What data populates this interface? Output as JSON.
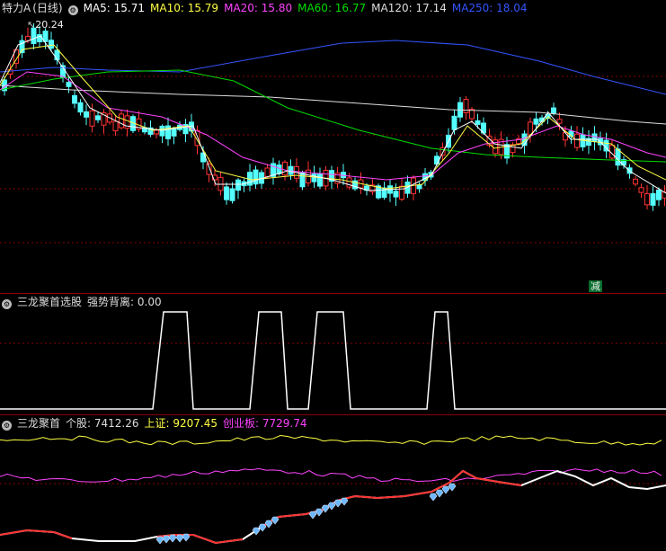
{
  "main_panel": {
    "stock_name": "特力A",
    "period": "(日线)",
    "ma": [
      {
        "label": "MA5: 15.71",
        "color": "#ffffff"
      },
      {
        "label": "MA10: 15.79",
        "color": "#ffff44"
      },
      {
        "label": "MA20: 15.80",
        "color": "#ff44ff"
      },
      {
        "label": "MA60: 16.77",
        "color": "#00dd00"
      },
      {
        "label": "MA120: 17.14",
        "color": "#dddddd"
      },
      {
        "label": "MA250: 18.04",
        "color": "#3355ff"
      }
    ],
    "high_label": "20.24",
    "signal_label": "减"
  },
  "indicator_panel": {
    "name": "三龙聚首选股",
    "param_label": "强势背离: 0.00"
  },
  "bottom_panel": {
    "name": "三龙聚首",
    "stock_value": "个股: 7412.26",
    "sh_value": "上证: 9207.45",
    "cyb_value": "创业板: 7729.74"
  },
  "colors": {
    "up": "#ff3333",
    "down": "#54ffff",
    "ma5": "#ffffff",
    "ma10": "#ffff44",
    "ma20": "#ff44ff",
    "ma60": "#00dd00",
    "ma120": "#dddddd",
    "ma250": "#3355ff",
    "grid": "#8b0000"
  }
}
